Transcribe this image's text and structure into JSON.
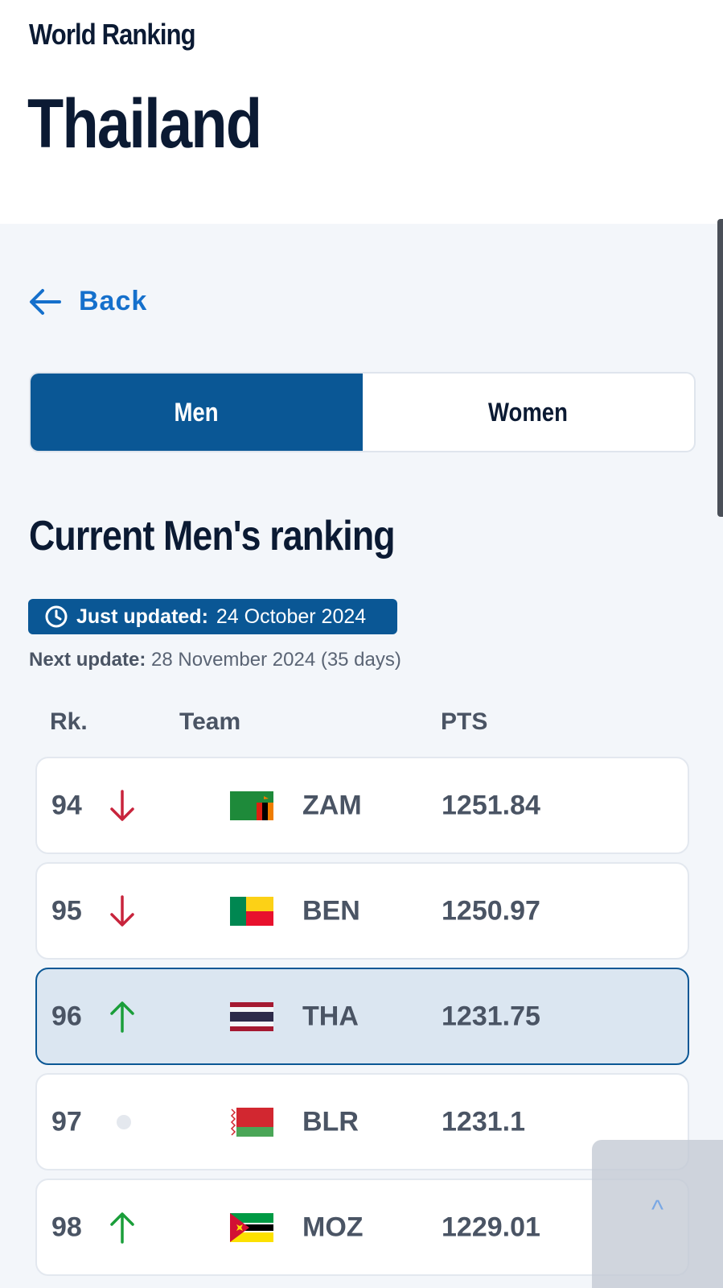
{
  "header": {
    "eyebrow": "World Ranking",
    "country": "Thailand"
  },
  "nav": {
    "back_label": "Back"
  },
  "toggle": {
    "men": "Men",
    "women": "Women",
    "selected": "Men"
  },
  "section": {
    "title": "Current Men's ranking",
    "updated_label": "Just updated:",
    "updated_date": "24 October 2024",
    "next_label": "Next update:",
    "next_date": "28 November 2024 (35 days)"
  },
  "table": {
    "headers": {
      "rank": "Rk.",
      "team": "Team",
      "pts": "PTS"
    },
    "rows": [
      {
        "rank": "94",
        "trend": "down",
        "flag": "zambia-flag-icon",
        "code": "ZAM",
        "pts": "1251.84"
      },
      {
        "rank": "95",
        "trend": "down",
        "flag": "benin-flag-icon",
        "code": "BEN",
        "pts": "1250.97"
      },
      {
        "rank": "96",
        "trend": "up",
        "flag": "thailand-flag-icon",
        "code": "THA",
        "pts": "1231.75",
        "highlighted": true
      },
      {
        "rank": "97",
        "trend": "none",
        "flag": "belarus-flag-icon",
        "code": "BLR",
        "pts": "1231.1"
      },
      {
        "rank": "98",
        "trend": "up",
        "flag": "mozambique-flag-icon",
        "code": "MOZ",
        "pts": "1229.01"
      }
    ]
  },
  "scroll_top": {
    "label": "^"
  },
  "colors": {
    "brand": "#0a5795",
    "link": "#1570cc",
    "trend_up": "#1a9e3a",
    "trend_down": "#c8243c",
    "background": "#f3f6fa"
  }
}
